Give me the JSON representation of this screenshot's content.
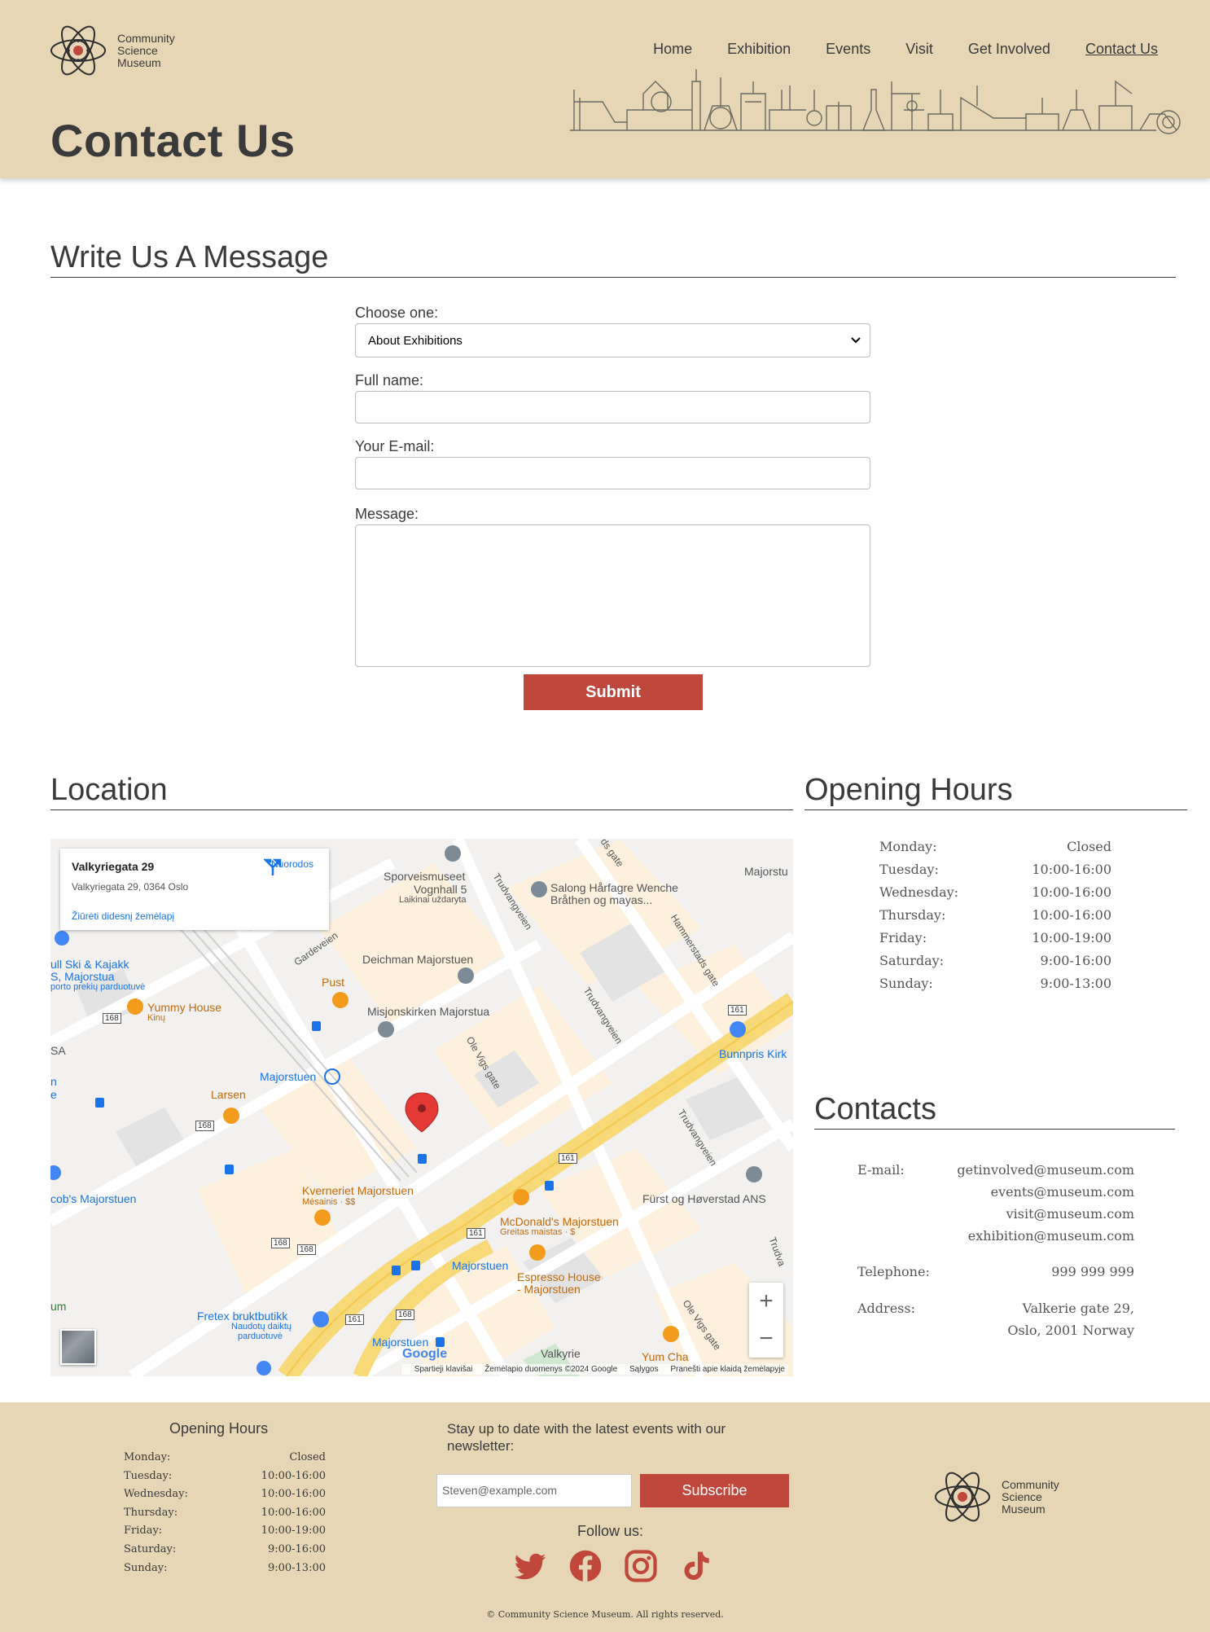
{
  "brand": {
    "line1": "Community",
    "line2": "Science",
    "line3": "Museum"
  },
  "nav": [
    "Home",
    "Exhibition",
    "Events",
    "Visit",
    "Get Involved",
    "Contact Us"
  ],
  "page_title": "Contact Us",
  "form_section": {
    "heading": "Write Us A Message",
    "choose_label": "Choose one:",
    "choose_value": "About Exhibitions",
    "name_label": "Full name:",
    "email_label": "Your E-mail:",
    "message_label": "Message:",
    "submit": "Submit"
  },
  "location": {
    "heading": "Location",
    "card_title": "Valkyriegata 29",
    "card_address": "Valkyriegata 29, 0364 Oslo",
    "card_link": "Žiūrėti didesnį žemėlapį",
    "card_directions": "Nuorodos",
    "labels": {
      "sporv": "Sporveismuseet",
      "vognhall": "Vognhall 5",
      "laikinai": "Laikinai uždaryta",
      "salong": "Salong Hårfagre Wenche",
      "brathen": "Bråthen og mayas...",
      "deichman": "Deichman Majorstuen",
      "misjons": "Misjonskirken Majorstua",
      "pust": "Pust",
      "yummy": "Yummy House",
      "kinu": "Kinų",
      "majorstuen_t": "Majorstuen",
      "larsen": "Larsen",
      "kverneriet": "Kverneriet Majorstuen",
      "mesainis": "Mėsainis · $$",
      "mcd": "McDonald's Majorstuen",
      "greitas": "Greitas maistas · $",
      "espresso1": "Espresso House",
      "espresso2": "- Majorstuen",
      "majorstuen_bus": "Majorstuen",
      "fretex": "Fretex bruktbutikk",
      "naudotu1": "Naudotų daiktų",
      "naudotu2": "parduotuvė",
      "majorstuen_bottom": "Majorstuen",
      "valkyrie": "Valkyrie",
      "yumcha": "Yum Cha",
      "bunnpris": "Bunnpris Kirk",
      "furst": "Fürst og Høverstad ANS",
      "ski1": "ull Ski & Kajakk",
      "ski2": "S, Majorstua",
      "ski3": "porto prekių parduotuvė",
      "jacobs": "cob's Majorstuen",
      "majorstu_top": "Majorstu",
      "sa": "SA",
      "um": "um",
      "n1": "n",
      "e1": "e",
      "street_gardeveien": "Gardeveien",
      "street_trud1": "Trudvangveien",
      "street_trud2": "Trudvangveien",
      "street_trud3": "Trudvangveien",
      "street_hammer": "Hammerstads gate",
      "street_ole": "Ole Vigs gate",
      "street_ole2": "Ole Vigs gate",
      "street_ds": "ds gate",
      "street_truda": "Trudva",
      "road_161a": "161",
      "road_161b": "161",
      "road_161c": "161",
      "road_161d": "161",
      "road_168a": "168",
      "road_168b": "168",
      "road_168c": "168",
      "road_168d": "168",
      "road_168e": "168"
    },
    "footer": [
      "Spartieji klavišai",
      "Žemėlapio duomenys ©2024 Google",
      "Sąlygos",
      "Pranešti apie klaidą žemėlapyje"
    ],
    "google": "Google",
    "zoom_in": "+",
    "zoom_out": "−"
  },
  "hours": {
    "heading": "Opening Hours",
    "rows": [
      {
        "day": "Monday:",
        "time": "Closed"
      },
      {
        "day": "Tuesday:",
        "time": "10:00-16:00"
      },
      {
        "day": "Wednesday:",
        "time": "10:00-16:00"
      },
      {
        "day": "Thursday:",
        "time": "10:00-16:00"
      },
      {
        "day": "Friday:",
        "time": "10:00-19:00"
      },
      {
        "day": "Saturday:",
        "time": "9:00-16:00"
      },
      {
        "day": "Sunday:",
        "time": "9:00-13:00"
      }
    ]
  },
  "contacts": {
    "heading": "Contacts",
    "email_label": "E-mail:",
    "emails": [
      "getinvolved@museum.com",
      "events@museum.com",
      "visit@museum.com",
      "exhibition@museum.com"
    ],
    "phone_label": "Telephone:",
    "phone": "999 999 999",
    "address_label": "Address:",
    "address1": "Valkerie gate 29,",
    "address2": "Oslo, 2001 Norway"
  },
  "footer": {
    "hours_title": "Opening Hours",
    "newsletter": "Stay up to date with the latest events with our newsletter:",
    "email_placeholder": "Steven@example.com",
    "subscribe": "Subscribe",
    "follow": "Follow us:",
    "copyright": "© Community Science Museum. All rights reserved."
  },
  "colors": {
    "beige": "#e6d6b5",
    "accent": "#c0473b",
    "text": "#3a3a3a"
  },
  "icons": [
    "atom-logo-icon",
    "chevron-down-icon",
    "directions-icon",
    "twitter-icon",
    "facebook-icon",
    "instagram-icon",
    "tiktok-icon",
    "map-pin-icon"
  ]
}
